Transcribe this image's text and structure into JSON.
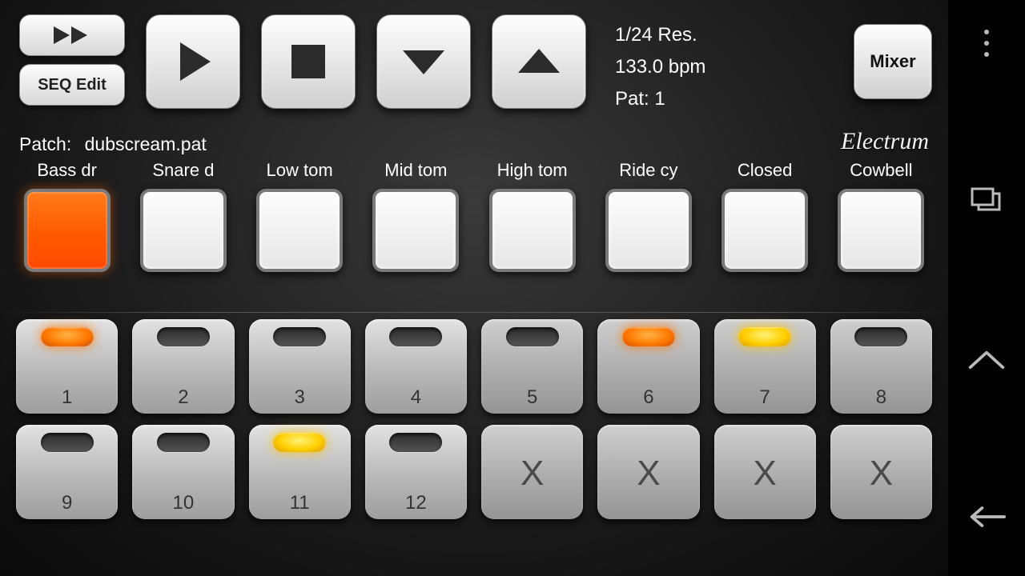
{
  "transport": {
    "seq_edit_label": "SEQ Edit",
    "resolution": "1/24 Res.",
    "bpm": "133.0 bpm",
    "pattern": "Pat: 1",
    "mixer_label": "Mixer"
  },
  "patch": {
    "label": "Patch:",
    "name": "dubscream.pat"
  },
  "brand": "Electrum",
  "instruments": [
    {
      "label": "Bass dr",
      "active": true
    },
    {
      "label": "Snare d",
      "active": false
    },
    {
      "label": "Low tom",
      "active": false
    },
    {
      "label": "Mid tom",
      "active": false
    },
    {
      "label": "High tom",
      "active": false
    },
    {
      "label": "Ride cy",
      "active": false
    },
    {
      "label": "Closed",
      "active": false
    },
    {
      "label": "Cowbell",
      "active": false
    }
  ],
  "steps": [
    {
      "num": "1",
      "led": "orange",
      "x": false
    },
    {
      "num": "2",
      "led": "off",
      "x": false
    },
    {
      "num": "3",
      "led": "off",
      "x": false
    },
    {
      "num": "4",
      "led": "off",
      "x": false
    },
    {
      "num": "5",
      "led": "off",
      "x": false,
      "shaded": true
    },
    {
      "num": "6",
      "led": "orange",
      "x": false,
      "shaded": true
    },
    {
      "num": "7",
      "led": "yellow",
      "x": false,
      "shaded": true
    },
    {
      "num": "8",
      "led": "off",
      "x": false,
      "shaded": true
    },
    {
      "num": "9",
      "led": "off",
      "x": false
    },
    {
      "num": "10",
      "led": "off",
      "x": false
    },
    {
      "num": "11",
      "led": "yellow",
      "x": false
    },
    {
      "num": "12",
      "led": "off",
      "x": false
    },
    {
      "num": "",
      "led": null,
      "x": true,
      "shaded": true
    },
    {
      "num": "",
      "led": null,
      "x": true,
      "shaded": true
    },
    {
      "num": "",
      "led": null,
      "x": true,
      "shaded": true
    },
    {
      "num": "",
      "led": null,
      "x": true,
      "shaded": true
    }
  ],
  "x_mark": "X"
}
